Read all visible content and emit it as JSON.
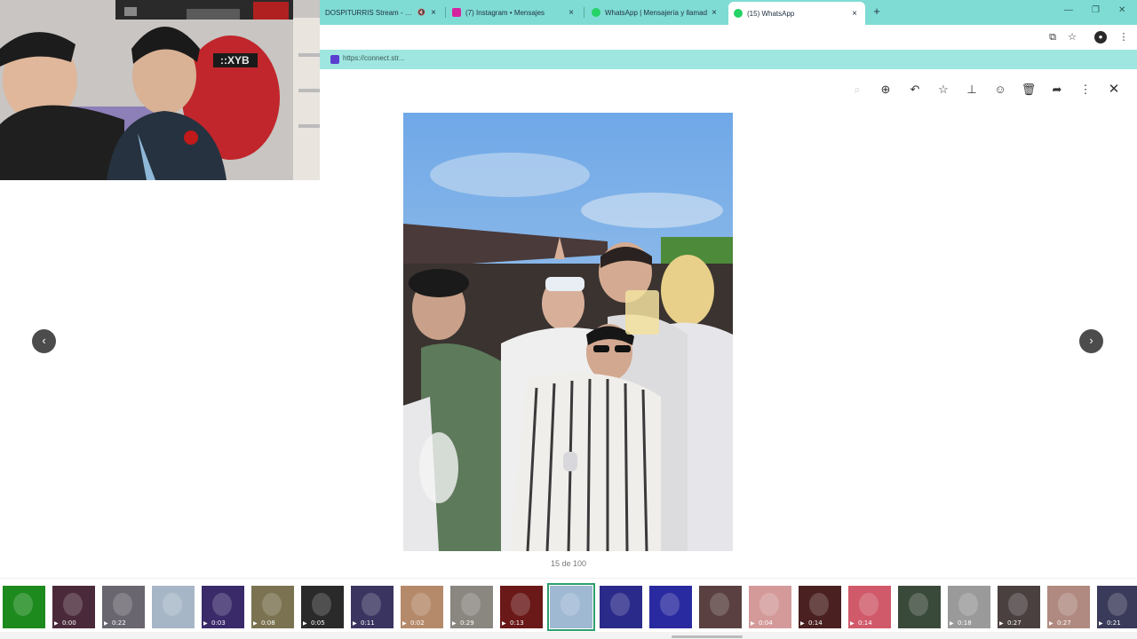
{
  "browser": {
    "tabs": [
      {
        "title": "DOSPITURRIS Stream - Wat",
        "muted_icon": "🔇",
        "color": "#6a4ccf"
      },
      {
        "title": "(7) Instagram • Mensajes",
        "color": "#d6249f"
      },
      {
        "title": "WhatsApp | Mensajería y llamad",
        "color": "#25d366"
      },
      {
        "title": "(15) WhatsApp",
        "color": "#25d366"
      }
    ],
    "close_glyph": "×",
    "newtab_glyph": "+",
    "url": "https://connect.str..."
  },
  "viewer": {
    "counter": "15 de 100",
    "prev_glyph": "‹",
    "next_glyph": "›"
  },
  "thumbnails": [
    {
      "duration": "",
      "color": "#1d8a1d"
    },
    {
      "duration": "0:00",
      "color": "#4a2a3a"
    },
    {
      "duration": "0:22",
      "color": "#6a6670"
    },
    {
      "duration": "",
      "color": "#a7b6c6"
    },
    {
      "duration": "0:03",
      "color": "#3a2a6a"
    },
    {
      "duration": "0:08",
      "color": "#7a7250"
    },
    {
      "duration": "0:05",
      "color": "#2a2a2a"
    },
    {
      "duration": "0:11",
      "color": "#3a3560"
    },
    {
      "duration": "0:02",
      "color": "#b58a6a"
    },
    {
      "duration": "0:29",
      "color": "#8a8680"
    },
    {
      "duration": "0:13",
      "color": "#6a1818"
    },
    {
      "duration": "",
      "color": "#9fb9d3"
    },
    {
      "duration": "",
      "color": "#2a2a8a"
    },
    {
      "duration": "",
      "color": "#2a2aa0"
    },
    {
      "duration": "",
      "color": "#5a4040"
    },
    {
      "duration": "0:04",
      "color": "#d49a9a"
    },
    {
      "duration": "0:14",
      "color": "#4a2020"
    },
    {
      "duration": "0:14",
      "color": "#d05a6a"
    },
    {
      "duration": "",
      "color": "#3a4a3a"
    },
    {
      "duration": "0:18",
      "color": "#9a9a9a"
    },
    {
      "duration": "0:27",
      "color": "#4a4040"
    },
    {
      "duration": "0:27",
      "color": "#b08a80"
    },
    {
      "duration": "0:21",
      "color": "#3a3a5a"
    }
  ]
}
